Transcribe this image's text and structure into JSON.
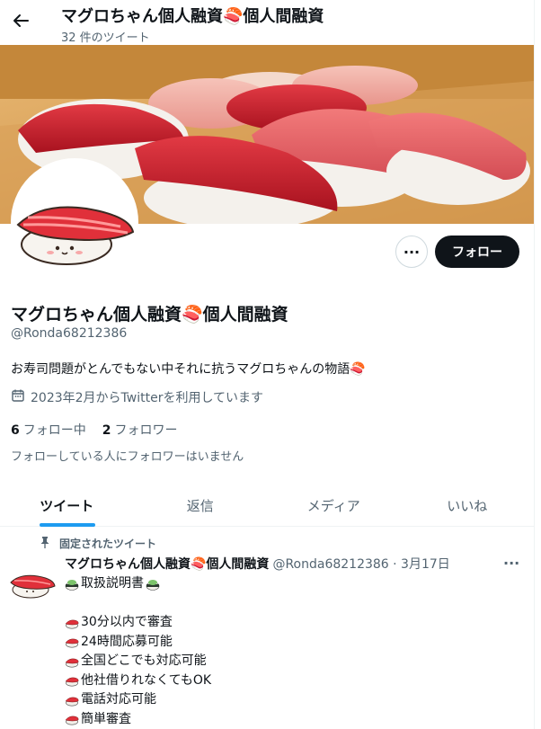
{
  "header": {
    "title": "マグロちゃん個人融資🍣個人間融資",
    "tweet_count": "32 件のツイート"
  },
  "profile": {
    "display_name": "マグロちゃん個人融資🍣個人間融資",
    "handle": "@Ronda68212386",
    "bio": "お寿司問題がとんでもない中それに抗うマグロちゃんの物語🍣",
    "joined": "2023年2月からTwitterを利用しています",
    "following_count": "6",
    "following_label": "フォロー中",
    "followers_count": "2",
    "followers_label": "フォロワー",
    "followers_note": "フォローしている人にフォロワーはいません",
    "follow_button": "フォロー",
    "more_button": "···"
  },
  "tabs": [
    {
      "label": "ツイート",
      "active": true
    },
    {
      "label": "返信",
      "active": false
    },
    {
      "label": "メディア",
      "active": false
    },
    {
      "label": "いいね",
      "active": false
    }
  ],
  "pinned_tweet": {
    "pinned_label": "固定されたツイート",
    "name": "マグロちゃん個人融資🍣個人間融資",
    "handle_date": "@Ronda68212386 · 3月17日",
    "more": "···",
    "lines": [
      "取扱説明書",
      "",
      "30分以内で審査",
      "24時間応募可能",
      "全国どこでも対応可能",
      "他社借りれなくてもOK",
      "電話対応可能",
      "簡単審査"
    ]
  },
  "icons": [
    "back-arrow-icon",
    "calendar-icon",
    "pin-icon",
    "more-icon",
    "sushi-icon",
    "wasabi-sushi-icon"
  ],
  "colors": {
    "accent": "#1d9bf0",
    "text": "#0f1419",
    "secondary": "#536471",
    "button_dark": "#0f1419",
    "tuna_red": "#d7263d"
  }
}
